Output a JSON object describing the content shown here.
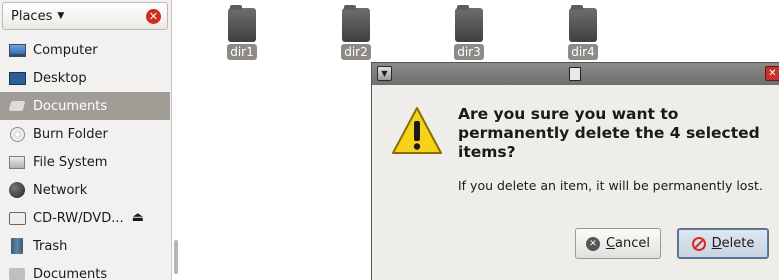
{
  "sidebar": {
    "header_label": "Places",
    "items": [
      {
        "label": "Computer",
        "icon": "computer-icon"
      },
      {
        "label": "Desktop",
        "icon": "desktop-icon"
      },
      {
        "label": "Documents",
        "icon": "documents-icon"
      },
      {
        "label": "Burn Folder",
        "icon": "burn-folder-icon"
      },
      {
        "label": "File System",
        "icon": "filesystem-icon"
      },
      {
        "label": "Network",
        "icon": "network-icon"
      },
      {
        "label": "CD-RW/DVD...",
        "icon": "cd-drive-icon"
      },
      {
        "label": "Trash",
        "icon": "trash-icon"
      },
      {
        "label": "Documents",
        "icon": "folder-icon"
      }
    ],
    "selected_index": 2
  },
  "files": [
    {
      "label": "dir1"
    },
    {
      "label": "dir2"
    },
    {
      "label": "dir3"
    },
    {
      "label": "dir4"
    }
  ],
  "dialog": {
    "title": "Are you sure you want to\npermanently delete the 4 selected\nitems?",
    "body": "If you delete an item, it will be permanently lost.",
    "cancel_mnemonic": "C",
    "cancel_rest": "ancel",
    "delete_mnemonic": "D",
    "delete_rest": "elete"
  },
  "colors": {
    "selected_row": "#a09d97",
    "warning_yellow": "#f6d21b",
    "danger_red": "#d62b1f"
  }
}
